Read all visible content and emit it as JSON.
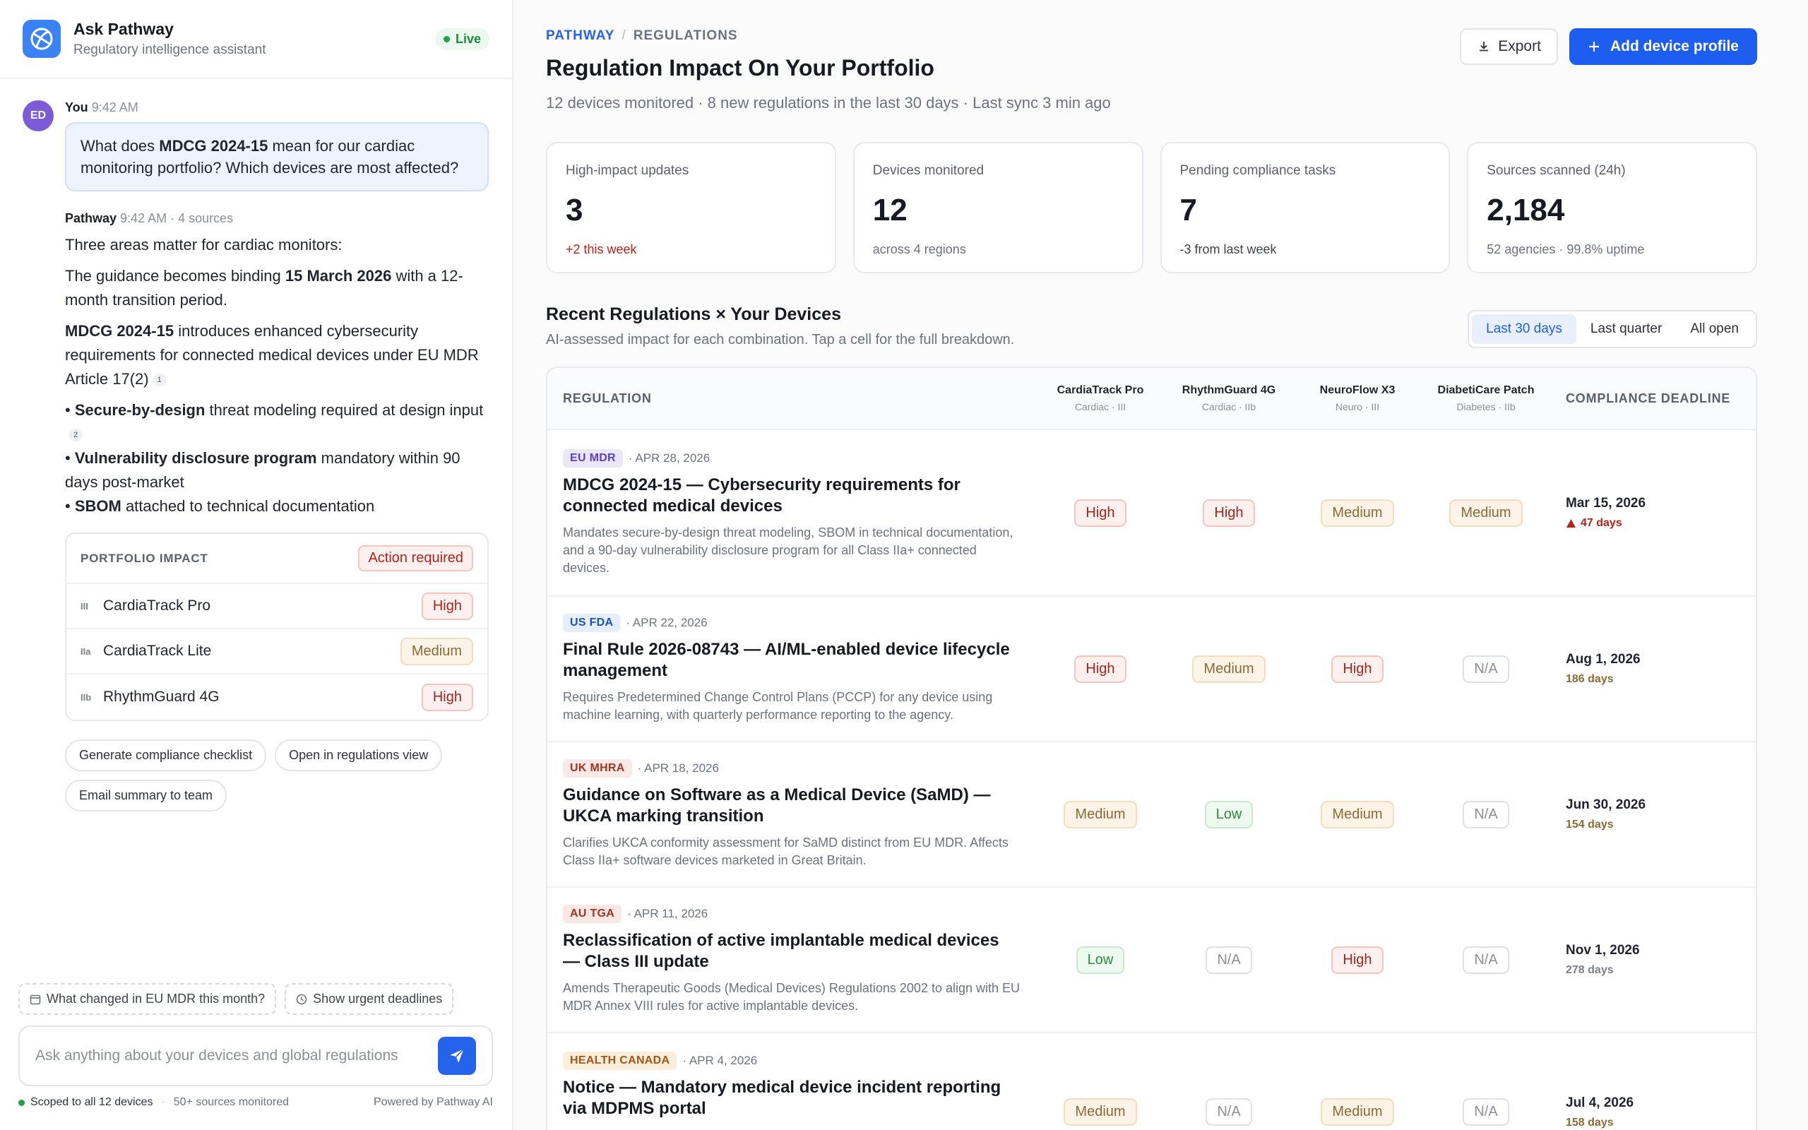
{
  "chat": {
    "title": "Ask Pathway",
    "subtitle": "Regulatory intelligence assistant",
    "live_label": "Live",
    "user_initials": "ED",
    "user_name": "You",
    "user_time": "9:42 AM",
    "question_pre": "What does ",
    "question_bold": "MDCG 2024-15",
    "question_post": " mean for our cardiac monitoring portfolio? Which devices are most affected?",
    "bot_name": "Pathway",
    "bot_meta": "9:42 AM · 4 sources",
    "intro": "Three areas matter for cardiac monitors:",
    "binding_pre": "The guidance becomes binding ",
    "binding_bold": "15 March 2026",
    "binding_post": " with a 12-month transition period.",
    "mdcg_bold": "MDCG 2024-15",
    "mdcg_post": " introduces enhanced cybersecurity requirements for connected medical devices under EU MDR Article 17(2)",
    "fn1": "1",
    "b1_bold": "Secure-by-design",
    "b1_post": " threat modeling required at design input",
    "fn2": "2",
    "b2_bold": "Vulnerability disclosure program",
    "b2_post": " mandatory within 90 days post-market",
    "b3_bold": "SBOM",
    "b3_post": " attached to technical documentation",
    "impact_title": "PORTFOLIO IMPACT",
    "action_label": "Action required",
    "impact_rows": [
      {
        "cls": "III",
        "device": "CardiaTrack Pro",
        "level": "High"
      },
      {
        "cls": "IIa",
        "device": "CardiaTrack Lite",
        "level": "Medium"
      },
      {
        "cls": "IIb",
        "device": "RhythmGuard 4G",
        "level": "High"
      }
    ],
    "chips": [
      "Generate compliance checklist",
      "Open in regulations view",
      "Email summary to team"
    ],
    "suggestions": [
      "What changed in EU MDR this month?",
      "Show urgent deadlines"
    ],
    "placeholder": "Ask anything about your devices and global regulations",
    "scope": "Scoped to all 12 devices",
    "sources": "50+ sources monitored",
    "powered": "Powered by Pathway AI"
  },
  "main": {
    "crumb_root": "PATHWAY",
    "crumb_sep": "/",
    "crumb_current": "REGULATIONS",
    "title": "Regulation Impact On Your Portfolio",
    "subtitle": "12 devices monitored · 8 new regulations in the last 30 days · Last sync 3 min ago",
    "export_label": "Export",
    "add_label": "Add device profile",
    "stats": [
      {
        "label": "High-impact updates",
        "value": "3",
        "note": "+2 this week"
      },
      {
        "label": "Devices monitored",
        "value": "12",
        "note": "across 4 regions"
      },
      {
        "label": "Pending compliance tasks",
        "value": "7",
        "note": "-3 from last week"
      },
      {
        "label": "Sources scanned (24h)",
        "value": "2,184",
        "note": "52 agencies · 99.8% uptime"
      }
    ],
    "section_title": "Recent Regulations × Your Devices",
    "section_sub": "AI-assessed impact for each combination. Tap a cell for the full breakdown.",
    "filters": [
      "Last 30 days",
      "Last quarter",
      "All open"
    ],
    "col_regulation": "REGULATION",
    "col_deadline": "COMPLIANCE DEADLINE",
    "devices": [
      {
        "name": "CardiaTrack Pro",
        "cat": "Cardiac · III"
      },
      {
        "name": "RhythmGuard 4G",
        "cat": "Cardiac · IIb"
      },
      {
        "name": "NeuroFlow X3",
        "cat": "Neuro · III"
      },
      {
        "name": "DiabetiCare Patch",
        "cat": "Diabetes · IIb"
      }
    ],
    "rows": [
      {
        "tag": "EU MDR",
        "date": "· APR 28, 2026",
        "title": "MDCG 2024-15 — Cybersecurity requirements for connected medical devices",
        "desc": "Mandates secure-by-design threat modeling, SBOM in technical documentation, and a 90-day vulnerability disclosure program for all Class IIa+ connected devices.",
        "impacts": [
          "High",
          "High",
          "Medium",
          "Medium"
        ],
        "deadline": "Mar 15, 2026",
        "days": "47 days"
      },
      {
        "tag": "US FDA",
        "date": "· APR 22, 2026",
        "title": "Final Rule 2026-08743 — AI/ML-enabled device lifecycle management",
        "desc": "Requires Predetermined Change Control Plans (PCCP) for any device using machine learning, with quarterly performance reporting to the agency.",
        "impacts": [
          "High",
          "Medium",
          "High",
          "N/A"
        ],
        "deadline": "Aug 1, 2026",
        "days": "186 days"
      },
      {
        "tag": "UK MHRA",
        "date": "· APR 18, 2026",
        "title": "Guidance on Software as a Medical Device (SaMD) — UKCA marking transition",
        "desc": "Clarifies UKCA conformity assessment for SaMD distinct from EU MDR. Affects Class IIa+ software devices marketed in Great Britain.",
        "impacts": [
          "Medium",
          "Low",
          "Medium",
          "N/A"
        ],
        "deadline": "Jun 30, 2026",
        "days": "154 days"
      },
      {
        "tag": "AU TGA",
        "date": "· APR 11, 2026",
        "title": "Reclassification of active implantable medical devices — Class III update",
        "desc": "Amends Therapeutic Goods (Medical Devices) Regulations 2002 to align with EU MDR Annex VIII rules for active implantable devices.",
        "impacts": [
          "Low",
          "N/A",
          "High",
          "N/A"
        ],
        "deadline": "Nov 1, 2026",
        "days": "278 days"
      },
      {
        "tag": "HEALTH CANADA",
        "date": "· APR 4, 2026",
        "title": "Notice — Mandatory medical device incident reporting via MDPMS portal",
        "desc": "",
        "impacts": [
          "Medium",
          "N/A",
          "Medium",
          "N/A"
        ],
        "deadline": "Jul 4, 2026",
        "days": "158 days"
      }
    ]
  }
}
